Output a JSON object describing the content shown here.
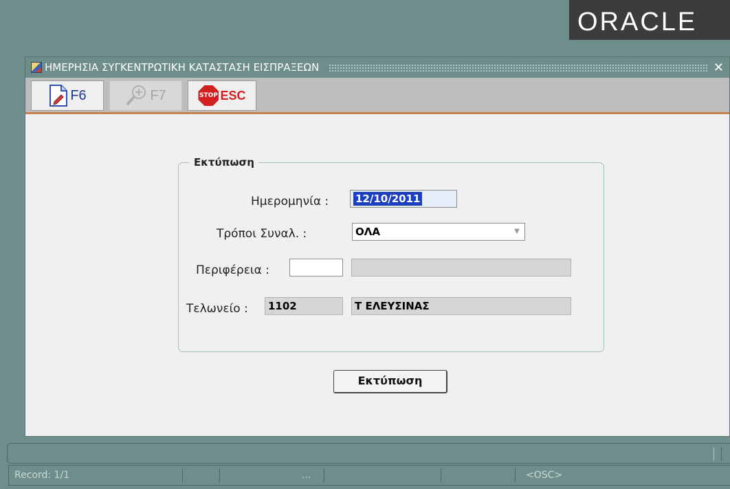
{
  "banner": {
    "logo_text": "ORACLE"
  },
  "window": {
    "title": "ΗΜΕΡΗΣΙΑ ΣΥΓΚΕΝΤΡΩΤΙΚΗ ΚΑΤΑΣΤΑΣΗ ΕΙΣΠΡΑΞΕΩΝ",
    "close_label": "✕"
  },
  "toolbar": {
    "new_label": "F6",
    "query_label": "F7",
    "stop_sign_text": "STOP",
    "exit_label": "ESC"
  },
  "form": {
    "group_title": "Εκτύπωση",
    "date_label": "Ημερομηνία :",
    "date_value": "12/10/2011",
    "payment_label": "Τρόποι Συναλ. :",
    "payment_value": "ΟΛΑ",
    "region_label": "Περιφέρεια :",
    "region_code": "",
    "region_name": "",
    "customs_label": "Τελωνείο :",
    "customs_code": "1102",
    "customs_name": "Τ ΕΛΕΥΣΙΝΑΣ",
    "print_button": "Εκτύπωση"
  },
  "status": {
    "record": "Record: 1/1",
    "ellipsis": "...",
    "mode": "<OSC>"
  }
}
